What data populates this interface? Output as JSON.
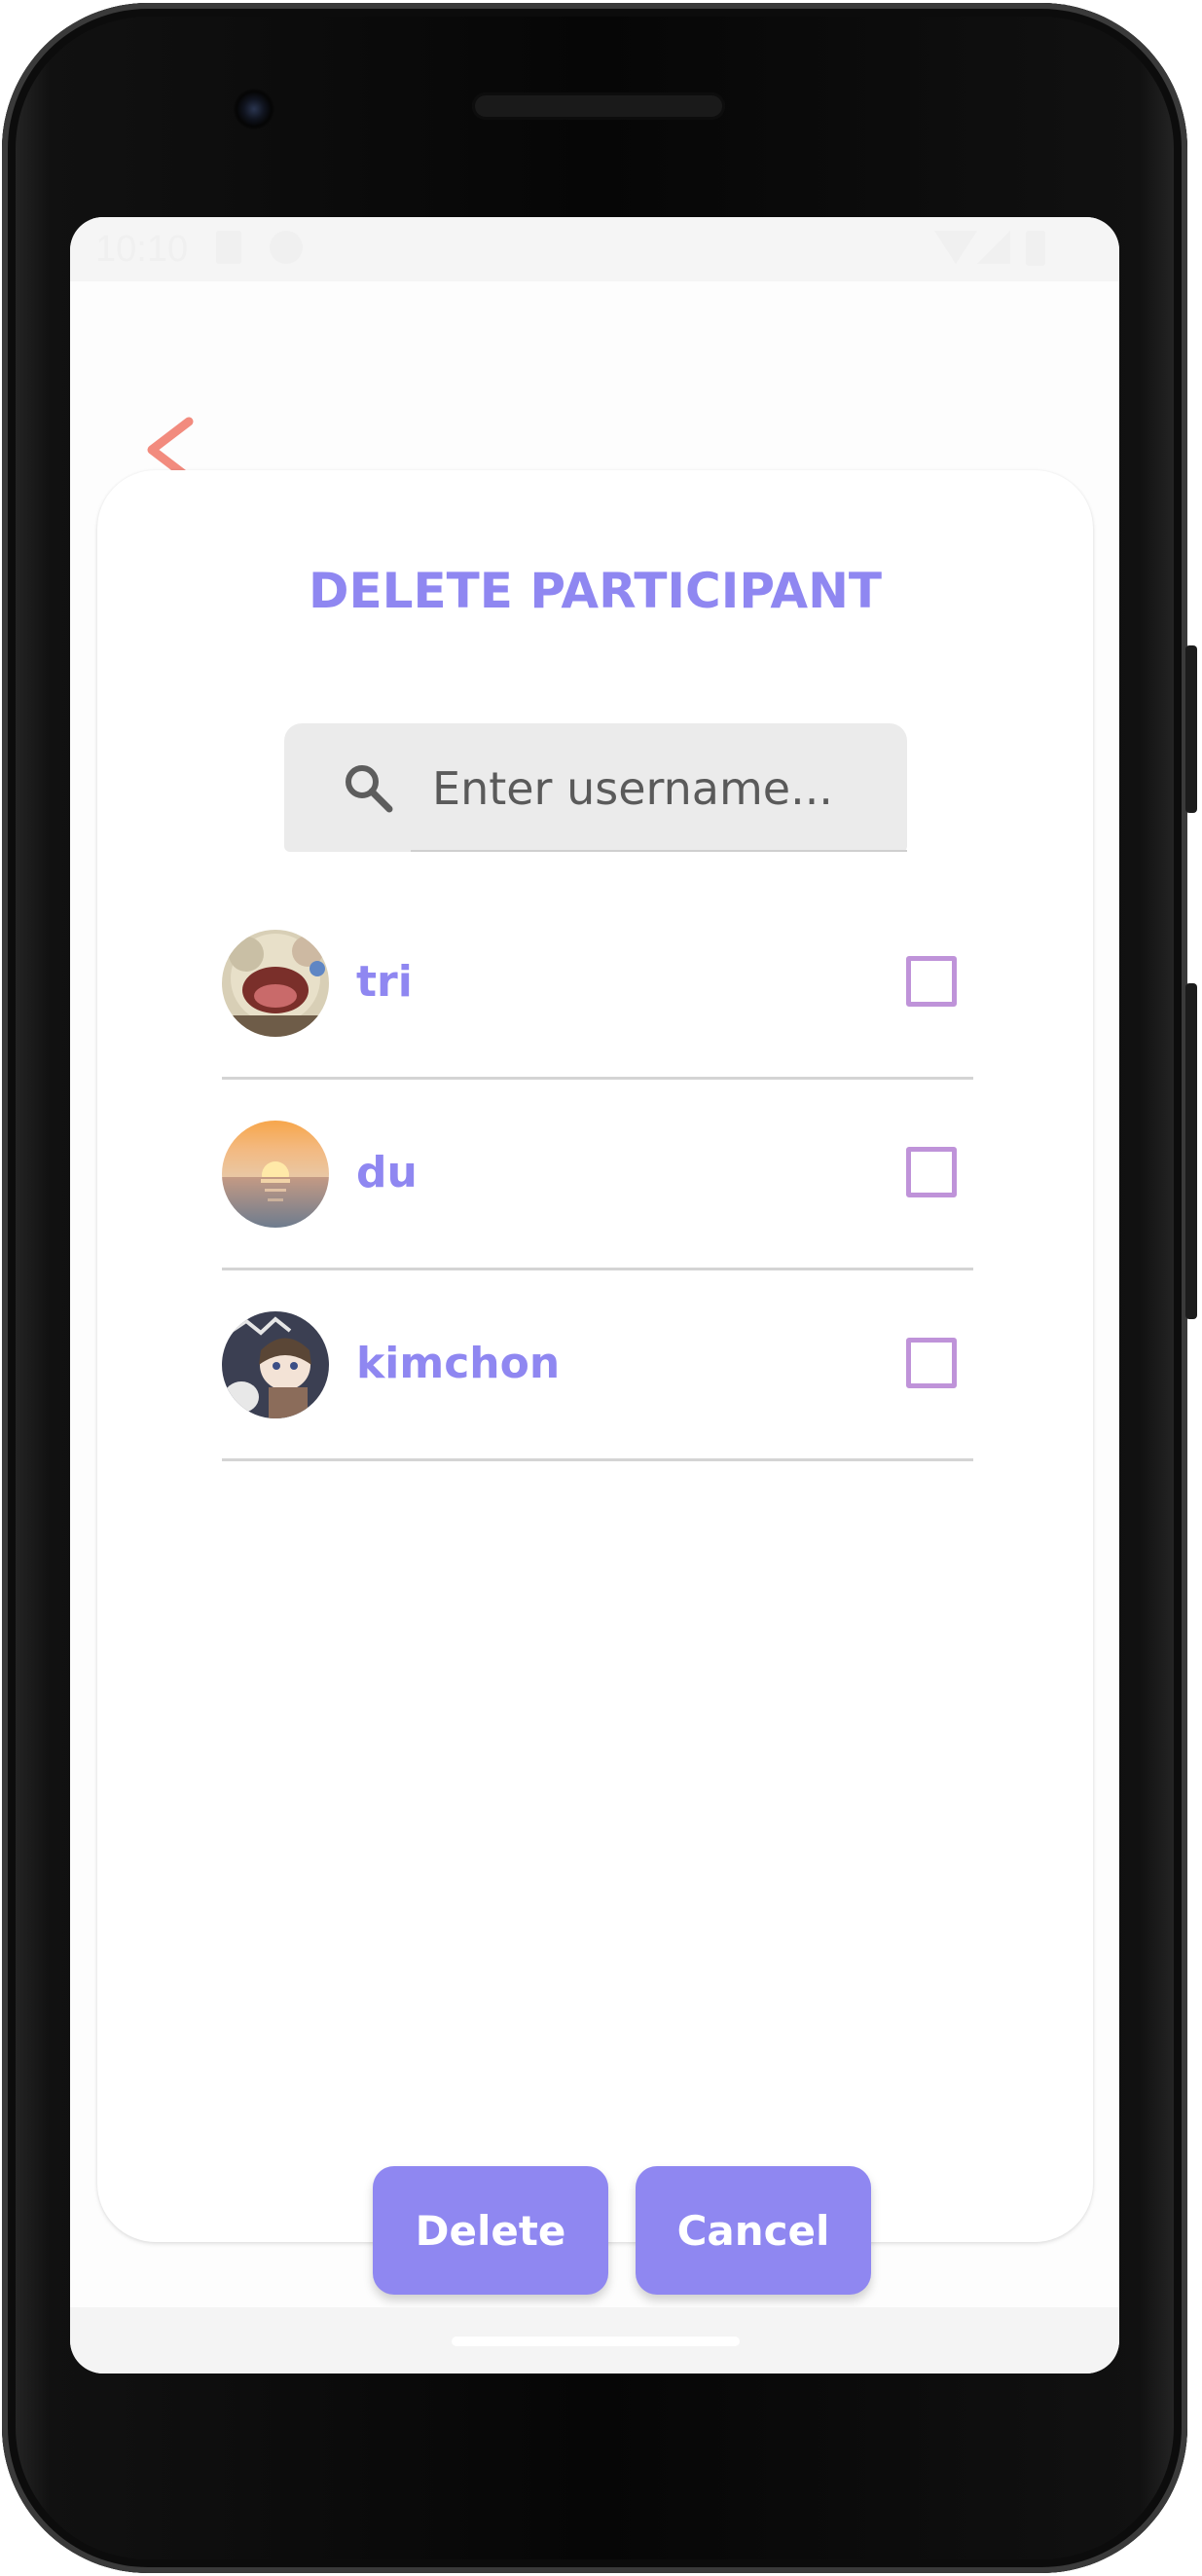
{
  "status_bar": {
    "time": "10:10"
  },
  "header": {
    "back_icon": "chevron-left-icon",
    "back_color": "#f28b7e"
  },
  "dialog": {
    "title": "DELETE PARTICIPANT",
    "search": {
      "placeholder": "Enter username...",
      "value": "",
      "icon": "search-icon"
    },
    "participants": [
      {
        "username": "tri",
        "selected": false
      },
      {
        "username": "du",
        "selected": false
      },
      {
        "username": "kimchon",
        "selected": false
      }
    ],
    "buttons": {
      "delete_label": "Delete",
      "cancel_label": "Cancel"
    }
  },
  "colors": {
    "accent": "#8f87f1",
    "checkbox_border": "#bf93d9",
    "back_arrow": "#f28b7e"
  }
}
